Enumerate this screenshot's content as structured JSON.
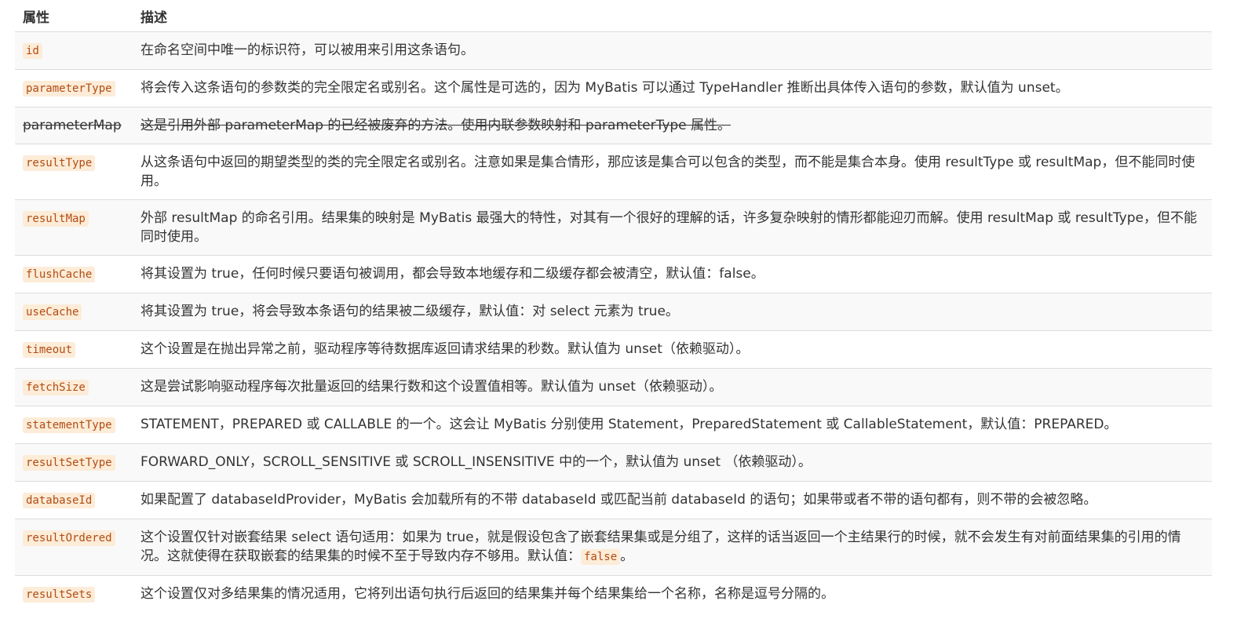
{
  "header": {
    "attr": "属性",
    "desc": "描述"
  },
  "rows": [
    {
      "attr": "id",
      "desc": "在命名空间中唯一的标识符，可以被用来引用这条语句。"
    },
    {
      "attr": "parameterType",
      "desc": "将会传入这条语句的参数类的完全限定名或别名。这个属性是可选的，因为 MyBatis 可以通过 TypeHandler 推断出具体传入语句的参数，默认值为 unset。"
    },
    {
      "attr": "parameterMap",
      "desc": "这是引用外部 parameterMap 的已经被废弃的方法。使用内联参数映射和 parameterType 属性。"
    },
    {
      "attr": "resultType",
      "desc": "从这条语句中返回的期望类型的类的完全限定名或别名。注意如果是集合情形，那应该是集合可以包含的类型，而不能是集合本身。使用 resultType 或 resultMap，但不能同时使用。"
    },
    {
      "attr": "resultMap",
      "desc": "外部 resultMap 的命名引用。结果集的映射是 MyBatis 最强大的特性，对其有一个很好的理解的话，许多复杂映射的情形都能迎刃而解。使用 resultMap 或 resultType，但不能同时使用。"
    },
    {
      "attr": "flushCache",
      "desc": "将其设置为 true，任何时候只要语句被调用，都会导致本地缓存和二级缓存都会被清空，默认值：false。"
    },
    {
      "attr": "useCache",
      "desc": "将其设置为 true，将会导致本条语句的结果被二级缓存，默认值：对 select 元素为 true。"
    },
    {
      "attr": "timeout",
      "desc": "这个设置是在抛出异常之前，驱动程序等待数据库返回请求结果的秒数。默认值为 unset（依赖驱动）。"
    },
    {
      "attr": "fetchSize",
      "desc": "这是尝试影响驱动程序每次批量返回的结果行数和这个设置值相等。默认值为 unset（依赖驱动）。"
    },
    {
      "attr": "statementType",
      "desc": "STATEMENT，PREPARED 或 CALLABLE 的一个。这会让 MyBatis 分别使用 Statement，PreparedStatement 或 CallableStatement，默认值：PREPARED。"
    },
    {
      "attr": "resultSetType",
      "desc": "FORWARD_ONLY，SCROLL_SENSITIVE 或 SCROLL_INSENSITIVE 中的一个，默认值为 unset （依赖驱动）。"
    },
    {
      "attr": "databaseId",
      "desc": "如果配置了 databaseIdProvider，MyBatis 会加载所有的不带 databaseId 或匹配当前 databaseId 的语句；如果带或者不带的语句都有，则不带的会被忽略。"
    },
    {
      "attr": "resultOrdered",
      "desc_before": "这个设置仅针对嵌套结果 select 语句适用：如果为 true，就是假设包含了嵌套结果集或是分组了，这样的话当返回一个主结果行的时候，就不会发生有对前面结果集的引用的情况。这就使得在获取嵌套的结果集的时候不至于导致内存不够用。默认值：",
      "desc_code": "false",
      "desc_after": "。"
    },
    {
      "attr": "resultSets",
      "desc": "这个设置仅对多结果集的情况适用，它将列出语句执行后返回的结果集并每个结果集给一个名称，名称是逗号分隔的。"
    }
  ]
}
